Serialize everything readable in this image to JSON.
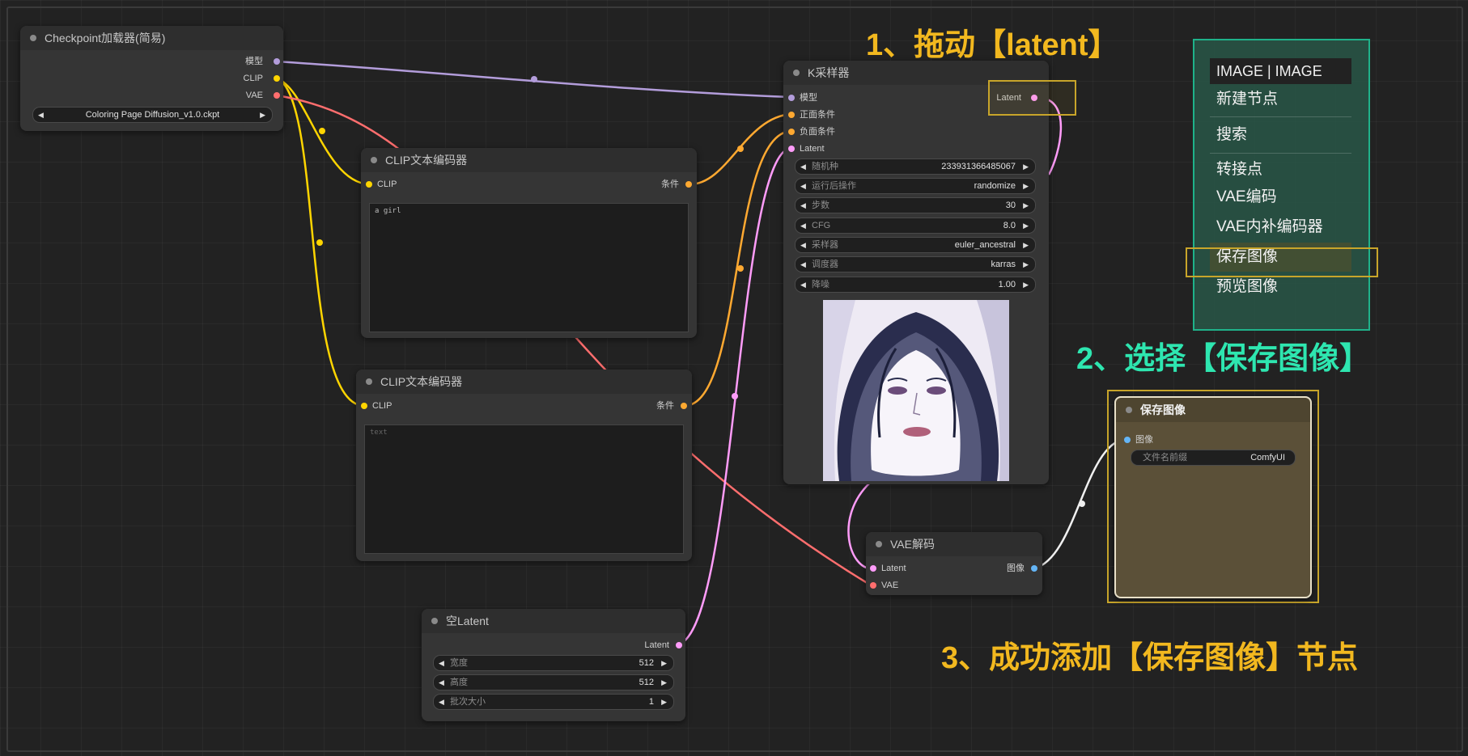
{
  "annotations": {
    "step1": "1、拖动【latent】",
    "step2": "2、选择【保存图像】",
    "step3": "3、成功添加【保存图像】节点"
  },
  "nodes": {
    "checkpoint": {
      "title": "Checkpoint加载器(简易)",
      "outputs": {
        "model": "模型",
        "clip": "CLIP",
        "vae": "VAE"
      },
      "ckpt_name": "Coloring Page Diffusion_v1.0.ckpt"
    },
    "clip1": {
      "title": "CLIP文本编码器",
      "input": "CLIP",
      "output": "条件",
      "text": "a girl"
    },
    "clip2": {
      "title": "CLIP文本编码器",
      "input": "CLIP",
      "output": "条件",
      "placeholder": "text"
    },
    "ksampler": {
      "title": "K采样器",
      "inputs": {
        "model": "模型",
        "positive": "正面条件",
        "negative": "负面条件",
        "latent": "Latent"
      },
      "output": "Latent",
      "widgets": [
        {
          "label": "随机种",
          "value": "233931366485067"
        },
        {
          "label": "运行后操作",
          "value": "randomize"
        },
        {
          "label": "步数",
          "value": "30"
        },
        {
          "label": "CFG",
          "value": "8.0"
        },
        {
          "label": "采样器",
          "value": "euler_ancestral"
        },
        {
          "label": "调度器",
          "value": "karras"
        },
        {
          "label": "降噪",
          "value": "1.00"
        }
      ]
    },
    "empty_latent": {
      "title": "空Latent",
      "output": "Latent",
      "widgets": [
        {
          "label": "宽度",
          "value": "512"
        },
        {
          "label": "高度",
          "value": "512"
        },
        {
          "label": "批次大小",
          "value": "1"
        }
      ]
    },
    "vae_decode": {
      "title": "VAE解码",
      "inputs": {
        "latent": "Latent",
        "vae": "VAE"
      },
      "output": "图像"
    },
    "save_image": {
      "title": "保存图像",
      "input": "图像",
      "widget": {
        "label": "文件名前缀",
        "value": "ComfyUI"
      }
    }
  },
  "context_menu": {
    "header": "IMAGE | IMAGE",
    "items": [
      "新建节点",
      "搜索",
      "转接点",
      "VAE编码",
      "VAE内补编码器",
      "保存图像",
      "预览图像"
    ],
    "highlighted_index": 5
  },
  "colors": {
    "canvas": "#222222",
    "node": "#353535",
    "model_wire": "#b39ddb",
    "clip_wire": "#ffd500",
    "vae_wire": "#ff6e6e",
    "cond_wire": "#ffa931",
    "latent_wire": "#ff9cf9",
    "image_wire": "#f0f0f0",
    "image_port": "#64b5f6",
    "annot_yellow": "#f2b81f",
    "annot_green": "#2ee6b0",
    "highlight_box": "#c8a52a",
    "menu_border": "#1fb28a"
  },
  "icons": {
    "left_arrow": "triangle-left-icon",
    "right_arrow": "triangle-right-icon"
  }
}
